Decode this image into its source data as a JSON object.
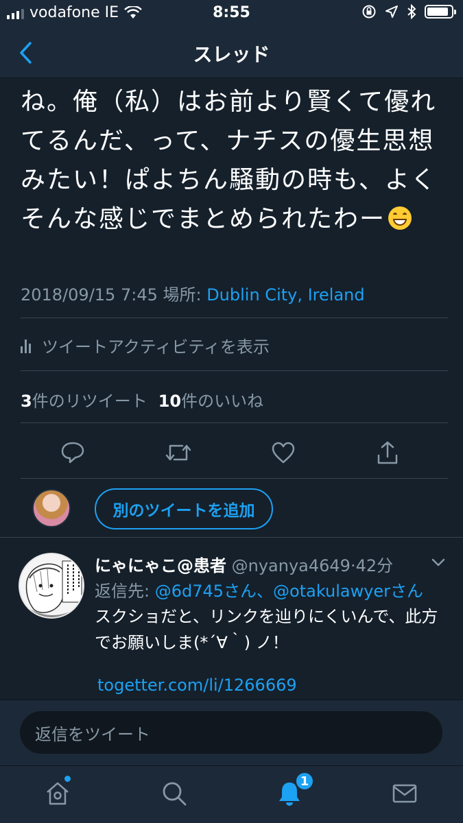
{
  "status_bar": {
    "carrier": "vodafone IE",
    "time": "8:55"
  },
  "nav": {
    "title": "スレッド"
  },
  "tweet": {
    "text": "ね。俺（私）はお前より賢くて優れてるんだ、って、ナチスの優生思想みたい！ぱよちん騒動の時も、よくそんな感じでまとめられたわー",
    "timestamp": "2018/09/15 7:45 場所: ",
    "location": "Dublin City, Ireland",
    "activity_label": "ツイートアクティビティを表示",
    "retweet_count": "3",
    "retweet_label": "件のリツイート",
    "like_count": "10",
    "like_label": "件のいいね",
    "add_tweet_label": "別のツイートを追加"
  },
  "reply": {
    "name": "にゃにゃこ@患者",
    "handle": " @nyanya4649",
    "separator": "·",
    "time": "42分",
    "reply_prefix": "返信先: ",
    "mention1": "@6d745さん",
    "mention_sep": "、",
    "mention2": "@otakulawyerさん",
    "text": "スクショだと、リンクを辿りにくいんで、此方でお願いしま(*´∀｀) ノ！",
    "link": "togetter.com/li/1266669"
  },
  "composer": {
    "placeholder": "返信をツイート"
  },
  "tabs": {
    "notifications_badge": "1"
  },
  "colors": {
    "background": "#15202b",
    "bar": "#1c2938",
    "accent": "#1da1f2",
    "muted": "#8899a6"
  },
  "icons": [
    "back-chevron-icon",
    "wifi-icon",
    "lock-rotation-icon",
    "location-arrow-icon",
    "bluetooth-icon",
    "battery-icon",
    "activity-bars-icon",
    "reply-icon",
    "retweet-icon",
    "like-icon",
    "share-icon",
    "chevron-down-icon",
    "home-icon",
    "search-icon",
    "notifications-icon",
    "messages-icon"
  ]
}
